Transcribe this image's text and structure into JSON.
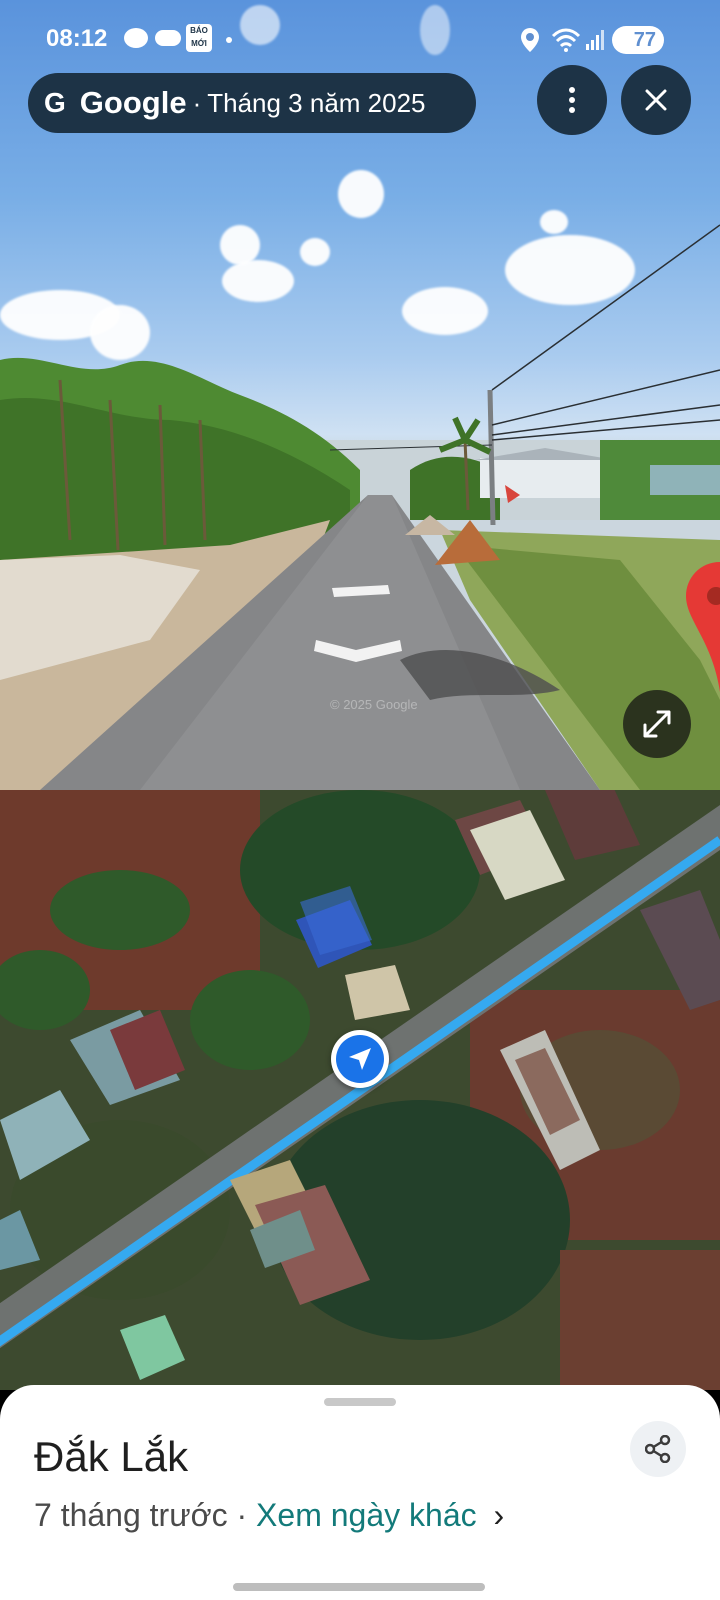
{
  "status_bar": {
    "time": "08:12",
    "app_badge": "BÁO MỚI",
    "battery": "77"
  },
  "streetview": {
    "brand": "Google",
    "separator": "·",
    "capture_date": "Tháng 3 năm 2025",
    "watermark": "© 2025 Google"
  },
  "sheet": {
    "place_name": "Đắk Lắk",
    "age_text": "7 tháng trước",
    "separator": "·",
    "other_dates_link": "Xem ngày khác",
    "link_chevron": "›"
  },
  "icons": {
    "more": "more-vert-icon",
    "close": "close-icon",
    "expand": "expand-icon",
    "share": "share-icon",
    "location_pin": "location-pin-icon",
    "navigation": "navigation-arrow-icon"
  },
  "colors": {
    "pill_bg": "#1d3346",
    "route_blue": "#35a9f0",
    "link_teal": "#137a7a",
    "nav_blue": "#1a73e8"
  }
}
